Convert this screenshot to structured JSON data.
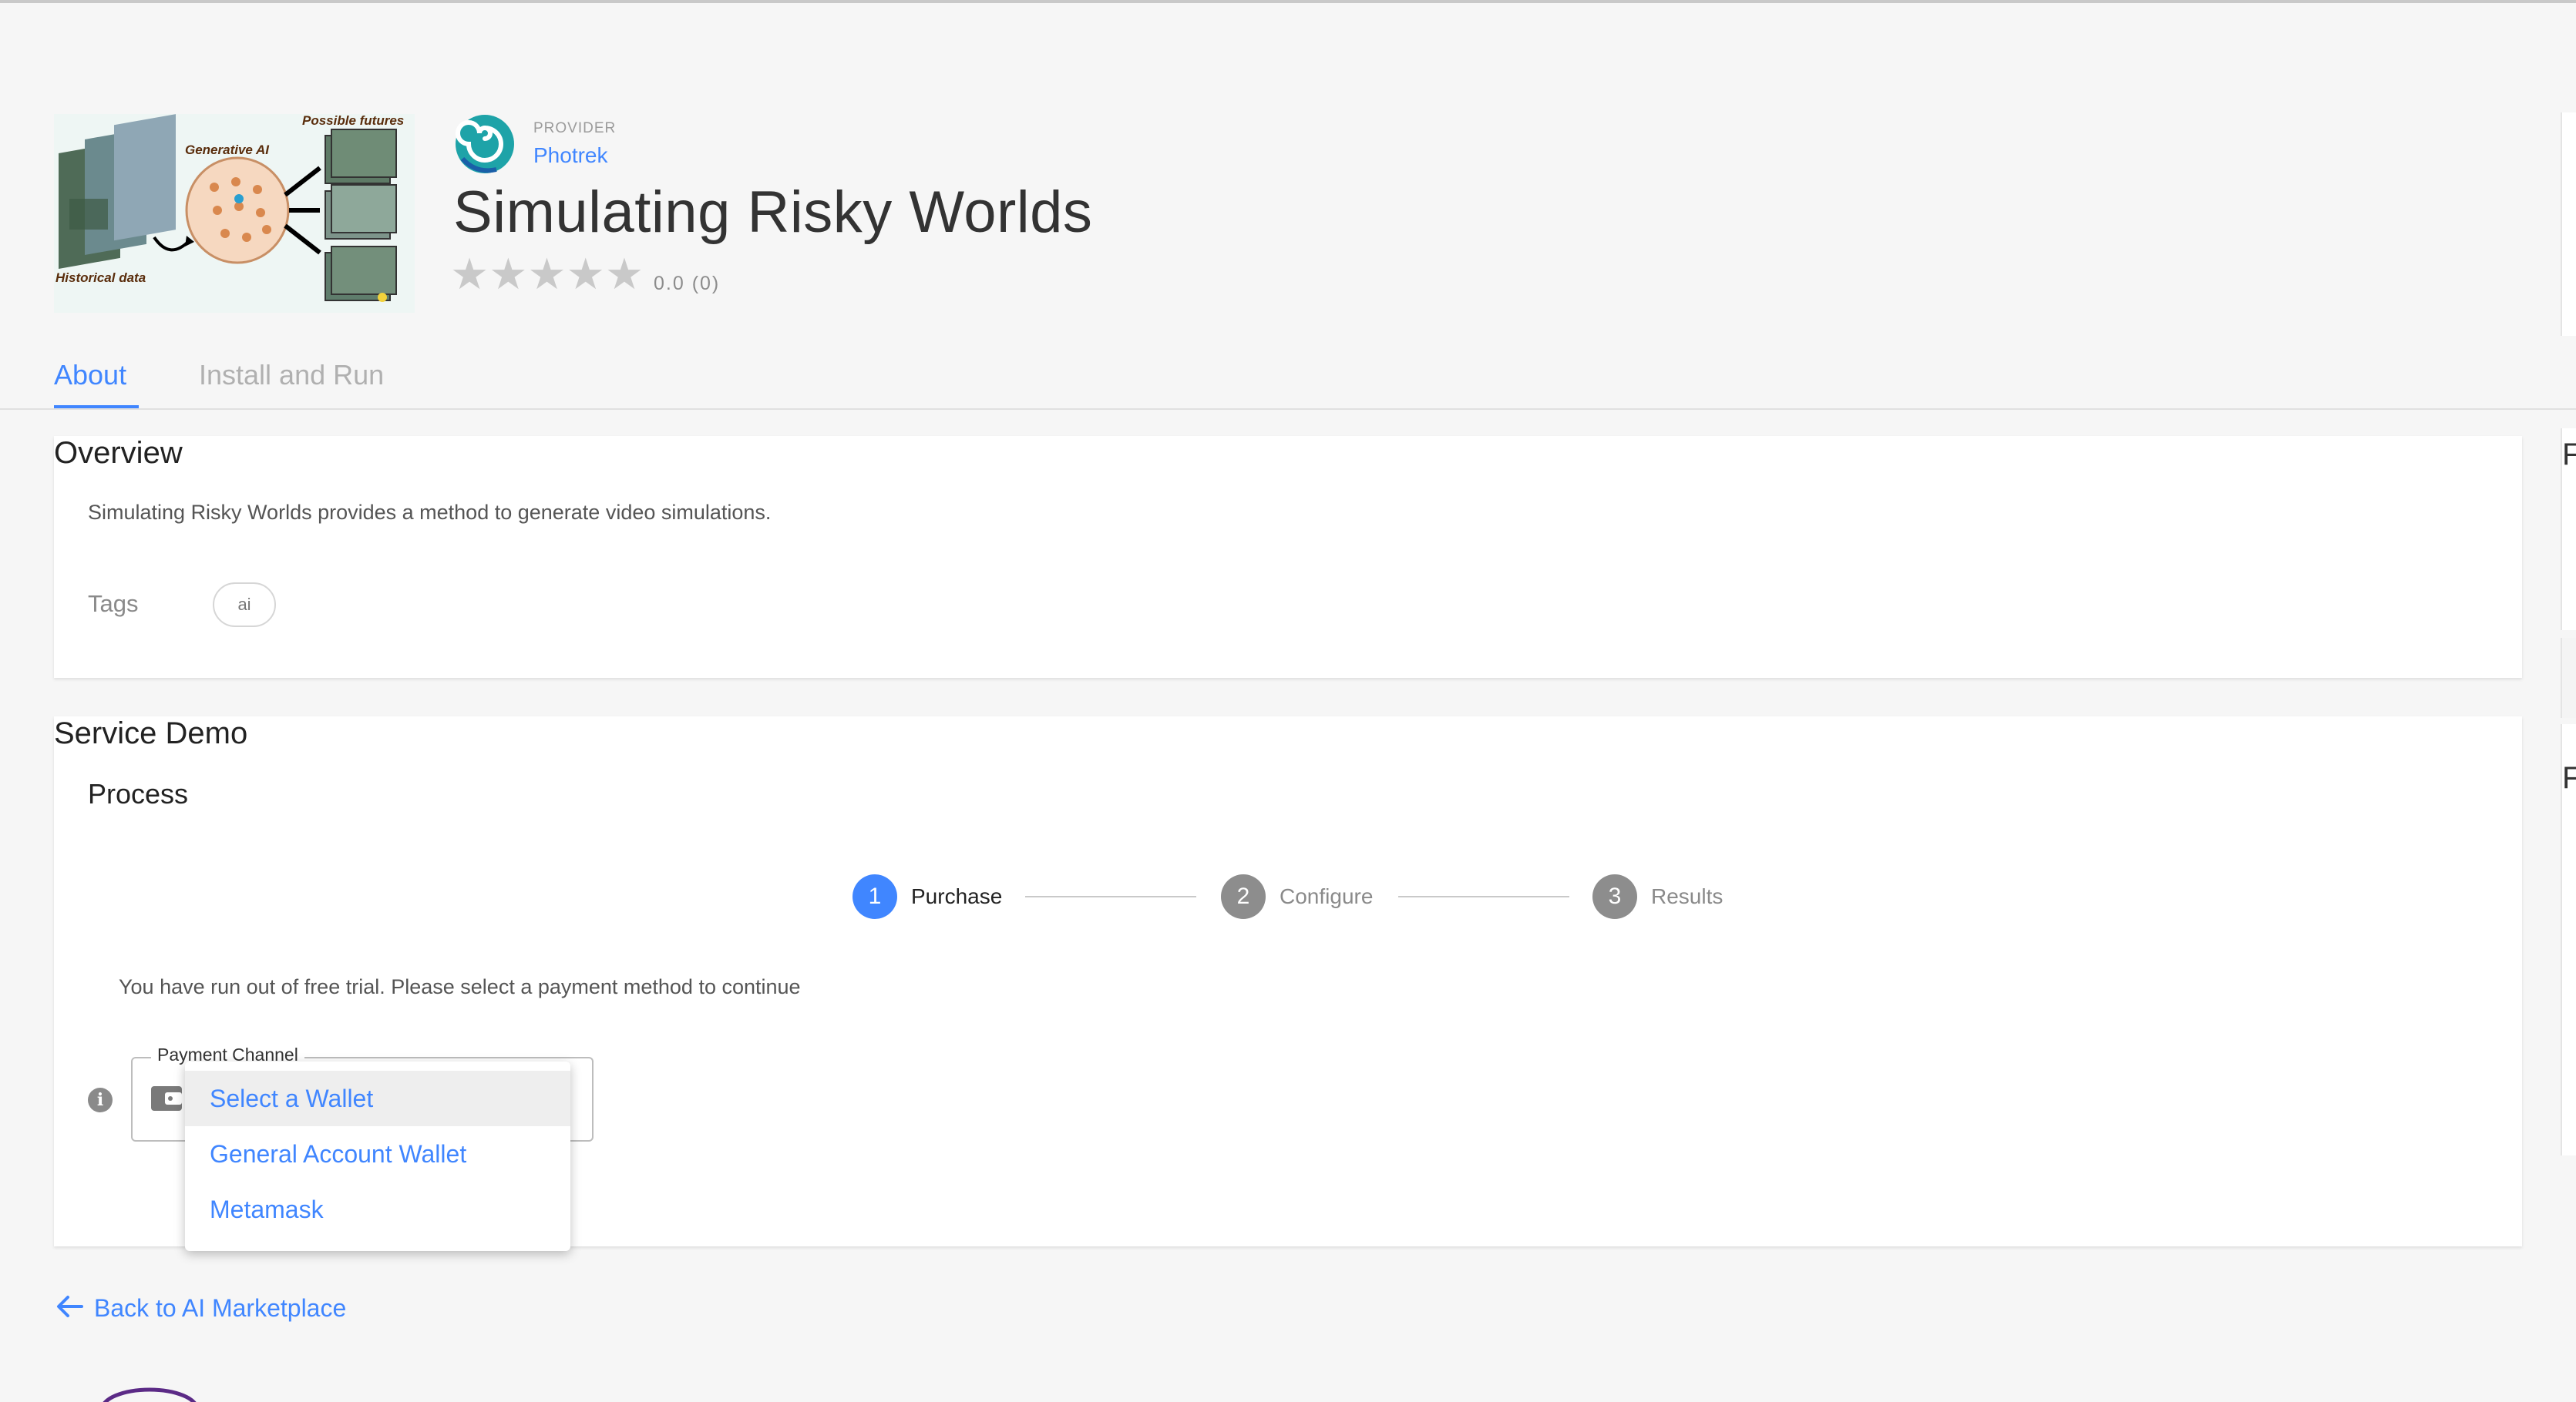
{
  "header": {
    "hero_image": {
      "alt": "Simulating Risky Worlds illustration",
      "label_generative": "Generative AI",
      "label_futures": "Possible futures",
      "label_history": "Historical data"
    },
    "provider_caption": "PROVIDER",
    "provider_name": "Photrek",
    "title": "Simulating Risky Worlds",
    "stars": "★★★★★",
    "rating_text": "0.0 (0)"
  },
  "tabs": [
    {
      "label": "About",
      "active": true
    },
    {
      "label": "Install and Run",
      "active": false
    }
  ],
  "overview": {
    "title": "Overview",
    "description": "Simulating Risky Worlds provides a method to generate video simulations.",
    "tags_label": "Tags",
    "tags": [
      "ai"
    ]
  },
  "demo": {
    "title": "Service Demo",
    "subtitle": "Process",
    "steps": [
      {
        "number": "1",
        "label": "Purchase",
        "state": "active"
      },
      {
        "number": "2",
        "label": "Configure",
        "state": "pending"
      },
      {
        "number": "3",
        "label": "Results",
        "state": "pending"
      }
    ],
    "trial_message": "You have run out of free trial. Please select a payment method to continue",
    "payment": {
      "legend": "Payment Channel",
      "options": [
        "Select a Wallet",
        "General Account Wallet",
        "Metamask"
      ],
      "highlighted_option": "Select a Wallet"
    }
  },
  "back_link": "Back to AI Marketplace",
  "right_edge": {
    "letter_top": "F",
    "letter_bottom": "F"
  },
  "colors": {
    "accent": "#4086ff",
    "step_idle": "#8d8d8d",
    "star": "#c9c9c9"
  },
  "icons": [
    "provider-logo-icon",
    "wallet-icon",
    "info-icon",
    "arrow-left-icon"
  ]
}
